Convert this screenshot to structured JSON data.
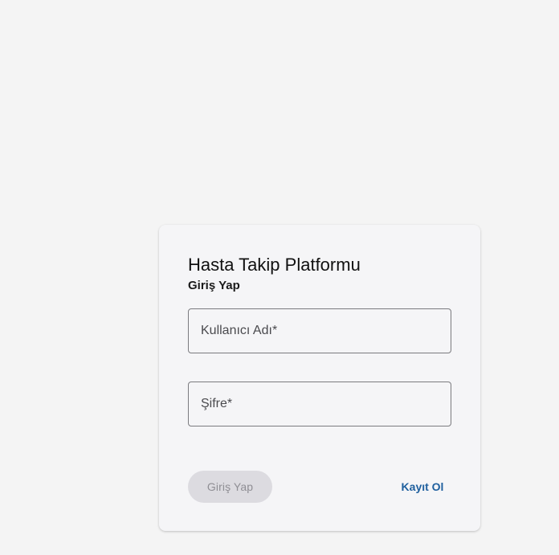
{
  "login_card": {
    "title": "Hasta Takip Platformu",
    "subtitle": "Giriş Yap",
    "username_field": {
      "placeholder": "Kullanıcı Adı*",
      "value": ""
    },
    "password_field": {
      "placeholder": "Şifre*",
      "value": ""
    },
    "login_button_label": "Giriş Yap",
    "register_button_label": "Kayıt Ol"
  },
  "colors": {
    "page_background": "#f4f4f4",
    "card_background": "#f5f5f7",
    "disabled_button_background": "#dcdbe0",
    "disabled_button_text": "#8f8e94",
    "link_accent": "#1e5f9e",
    "field_border": "#7b7b7f"
  }
}
